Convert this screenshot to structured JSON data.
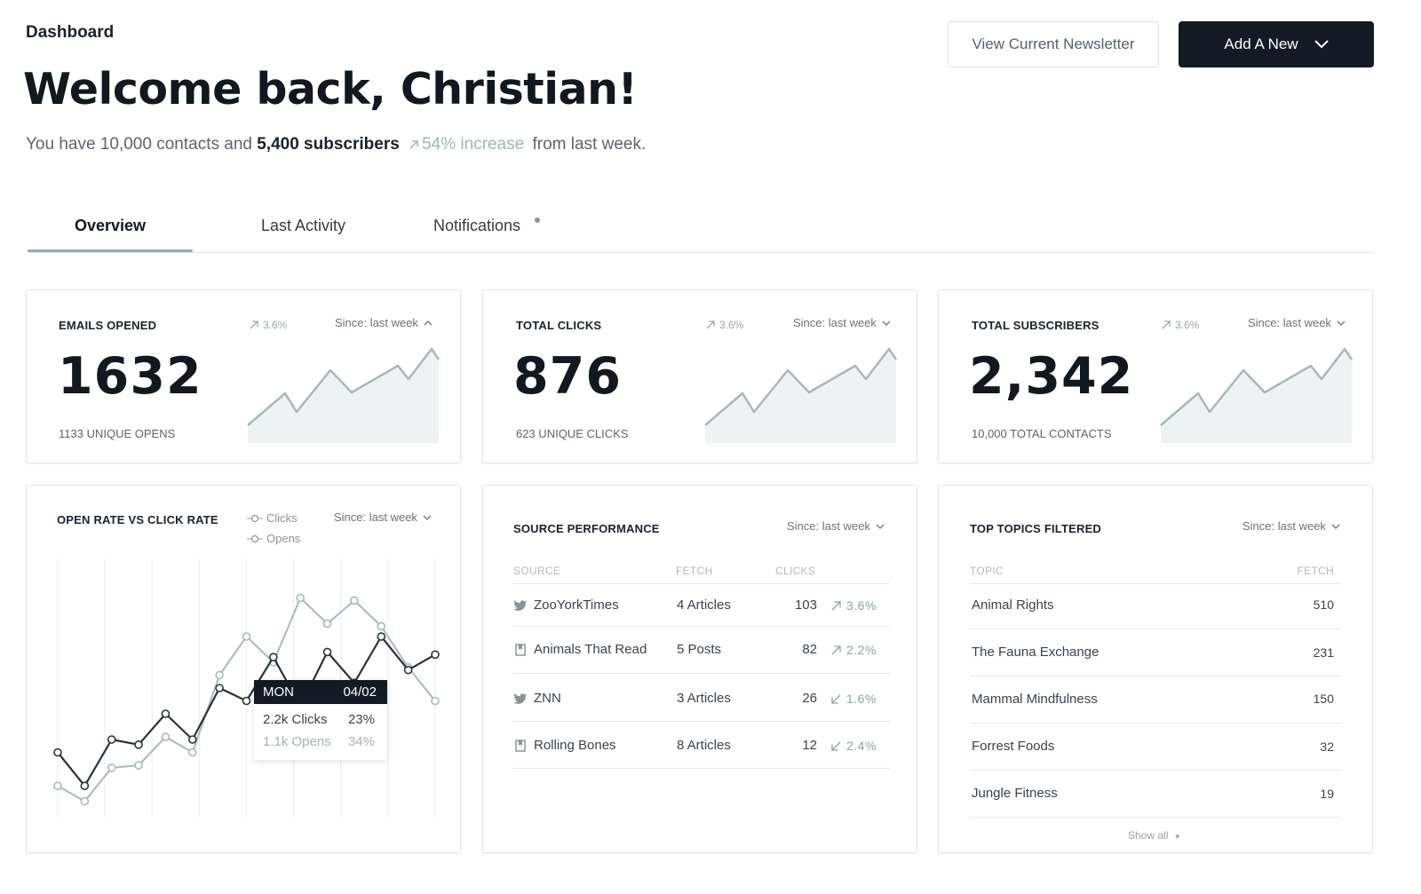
{
  "header": {
    "breadcrumb": "Dashboard",
    "welcome": "Welcome back, Christian!",
    "summary": {
      "prefix": "You have 10,000 contacts and",
      "subscribers": "5,400 subscribers",
      "increase": "54% increase",
      "suffix": "from last week."
    },
    "view_newsletter_label": "View Current Newsletter",
    "add_new_label": "Add A New"
  },
  "tabs": [
    {
      "label": "Overview",
      "active": true
    },
    {
      "label": "Last Activity",
      "active": false
    },
    {
      "label": "Notifications",
      "active": false,
      "has_indicator": true
    }
  ],
  "stats": [
    {
      "title": "EMAILS OPENED",
      "trend": "3.6%",
      "since": "Since: last week",
      "chevron": "chevron-up",
      "value": "1632",
      "subcaption": "1133 UNIQUE OPENS"
    },
    {
      "title": "TOTAL CLICKS",
      "trend": "3.6%",
      "since": "Since: last week",
      "chevron": "chevron-down",
      "value": "876",
      "subcaption": "623 UNIQUE CLICKS"
    },
    {
      "title": "TOTAL SUBSCRIBERS",
      "trend": "3.6%",
      "since": "Since: last week",
      "chevron": "chevron-down",
      "value": "2,342",
      "subcaption": "10,000 TOTAL CONTACTS"
    }
  ],
  "rate_chart": {
    "title": "OPEN RATE VS CLICK RATE",
    "legend": [
      "Clicks",
      "Opens"
    ],
    "since": "Since: last week",
    "tooltip": {
      "day": "MON",
      "date": "04/02",
      "clicks_value": "2.2k Clicks",
      "clicks_pct": "23%",
      "opens_value": "1.1k Opens",
      "opens_pct": "34%"
    },
    "colors": {
      "clicks": "#2b323b",
      "opens": "#a9bab8"
    }
  },
  "chart_data": {
    "type": "line",
    "title": "OPEN RATE VS CLICK RATE",
    "series": [
      {
        "name": "Clicks",
        "values": [
          0.25,
          0.12,
          0.3,
          0.28,
          0.4,
          0.3,
          0.5,
          0.45,
          0.62,
          0.43,
          0.64,
          0.52,
          0.7,
          0.57,
          0.63
        ]
      },
      {
        "name": "Opens",
        "values": [
          0.12,
          0.06,
          0.19,
          0.2,
          0.31,
          0.25,
          0.55,
          0.7,
          0.6,
          0.85,
          0.75,
          0.84,
          0.74,
          0.58,
          0.45
        ]
      }
    ]
  },
  "source_performance": {
    "title": "SOURCE PERFORMANCE",
    "since": "Since: last week",
    "columns": [
      "SOURCE",
      "FETCH",
      "CLICKS"
    ],
    "rows": [
      {
        "icon": "twitter-icon",
        "source": "ZooYorkTimes",
        "fetch": "4 Articles",
        "clicks": "103",
        "direction": "up",
        "pct": "3.6%"
      },
      {
        "icon": "bookmark-icon",
        "source": "Animals That Read",
        "fetch": "5 Posts",
        "clicks": "82",
        "direction": "up",
        "pct": "2.2%"
      },
      {
        "icon": "twitter-icon",
        "source": "ZNN",
        "fetch": "3 Articles",
        "clicks": "26",
        "direction": "down",
        "pct": "1.6%"
      },
      {
        "icon": "bookmark-icon",
        "source": "Rolling Bones",
        "fetch": "8 Articles",
        "clicks": "12",
        "direction": "down",
        "pct": "2.4%"
      }
    ]
  },
  "top_topics": {
    "title": "TOP TOPICS FILTERED",
    "since": "Since: last week",
    "columns": [
      "TOPIC",
      "FETCH"
    ],
    "rows": [
      {
        "topic": "Animal Rights",
        "fetch": "510"
      },
      {
        "topic": "The Fauna Exchange",
        "fetch": "231"
      },
      {
        "topic": "Mammal Mindfulness",
        "fetch": "150"
      },
      {
        "topic": "Forrest Foods",
        "fetch": "32"
      },
      {
        "topic": "Jungle Fitness",
        "fetch": "19"
      }
    ],
    "show_all": "Show all"
  },
  "colors": {
    "dark": "#141a23",
    "accent_muted": "#9fb7b4",
    "border": "#e2e6e9",
    "sparkline_fill": "#eef2f3",
    "sparkline_stroke": "#a9b8b8"
  }
}
